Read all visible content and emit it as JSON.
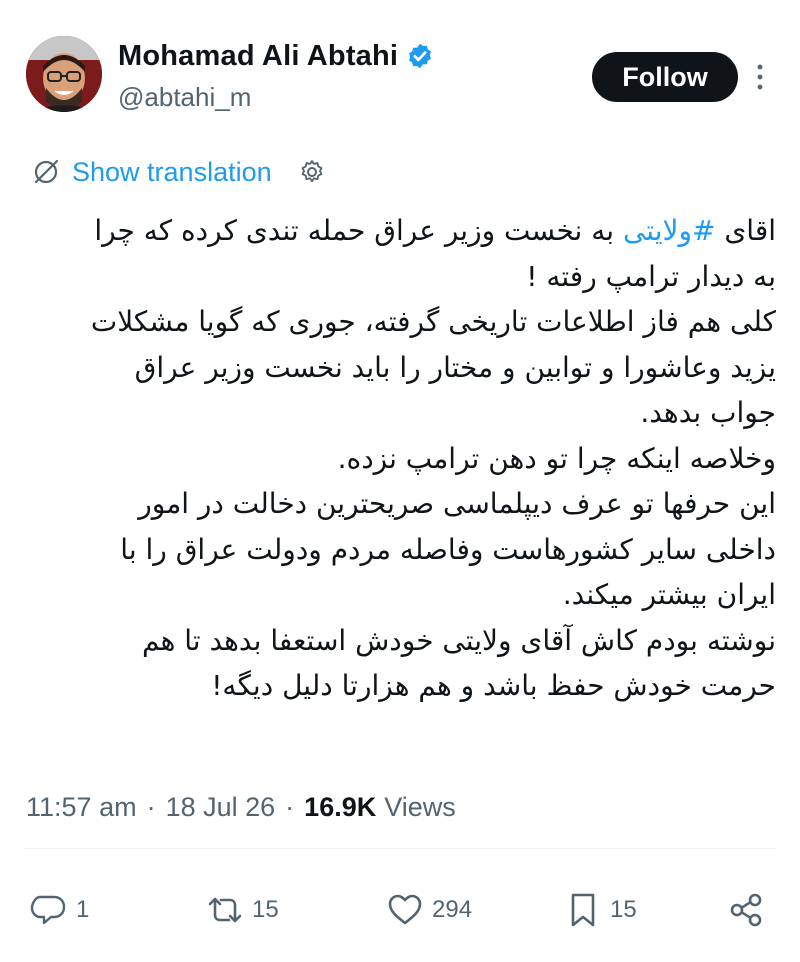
{
  "author": {
    "display_name": "Mohamad Ali Abtahi",
    "handle": "@abtahi_m",
    "verified": true
  },
  "follow_label": "Follow",
  "translate": {
    "label": "Show translation"
  },
  "tweet": {
    "line1_before_tag": "اقای ",
    "hashtag": "#ولایتی",
    "line1_after_tag": " به نخست وزیر عراق حمله تندی کرده که چرا",
    "lines": [
      "به دیدار ترامپ رفته !",
      "کلی هم فاز اطلاعات تاریخی گرفته، جوری که گویا مشکلات",
      "یزید وعاشورا و توابین و مختار را باید نخست وزیر عراق",
      "جواب بدهد.",
      "وخلاصه اینکه چرا تو دهن ترامپ نزده.",
      "این حرفها تو عرف دیپلماسی صریحترین دخالت در امور",
      "داخلی سایر کشورهاست وفاصله مردم ودولت عراق را با",
      "ایران بیشتر میکند.",
      "نوشته بودم کاش آقای ولایتی خودش استعفا بدهد تا هم",
      "حرمت خودش حفظ باشد و هم هزارتا دلیل دیگه!"
    ]
  },
  "meta": {
    "time": "11:57 am",
    "date": "18 Jul 26",
    "views_count": "16.9K",
    "views_label": "Views",
    "separator": "·"
  },
  "actions": {
    "replies": "1",
    "reposts": "15",
    "likes": "294",
    "bookmarks": "15"
  },
  "colors": {
    "accent": "#1d9bf0",
    "text": "#0f1419",
    "muted": "#536471",
    "button_bg": "#0f1419"
  },
  "icons": [
    "verified-badge-icon",
    "more-icon",
    "globe-icon",
    "gear-icon",
    "reply-icon",
    "repost-icon",
    "like-icon",
    "bookmark-icon",
    "share-icon"
  ]
}
